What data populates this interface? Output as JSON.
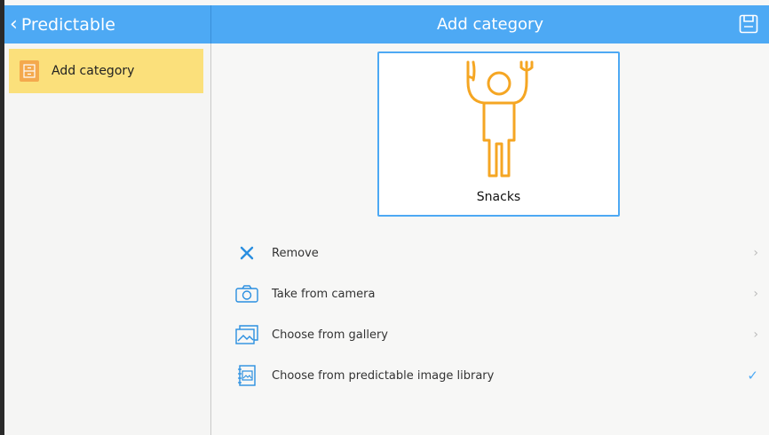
{
  "colors": {
    "accent": "#4da9f4",
    "selected": "#fbe07b",
    "icon_orange": "#f4a94d"
  },
  "nav": {
    "back_label": "Predictable",
    "back_icon": "chevron-left-icon"
  },
  "header": {
    "title": "Add category",
    "save_icon": "save-icon"
  },
  "sidebar": {
    "items": [
      {
        "label": "Add category",
        "icon": "category-icon",
        "selected": true
      }
    ]
  },
  "preview": {
    "label": "Snacks",
    "image": "person-with-fork-and-knife"
  },
  "options": [
    {
      "label": "Remove",
      "icon": "close-icon",
      "trail": "›"
    },
    {
      "label": "Take from camera",
      "icon": "camera-icon",
      "trail": "›"
    },
    {
      "label": "Choose from gallery",
      "icon": "gallery-icon",
      "trail": "›"
    },
    {
      "label": "Choose from predictable image library",
      "icon": "image-library-icon",
      "trail": "✓"
    }
  ]
}
